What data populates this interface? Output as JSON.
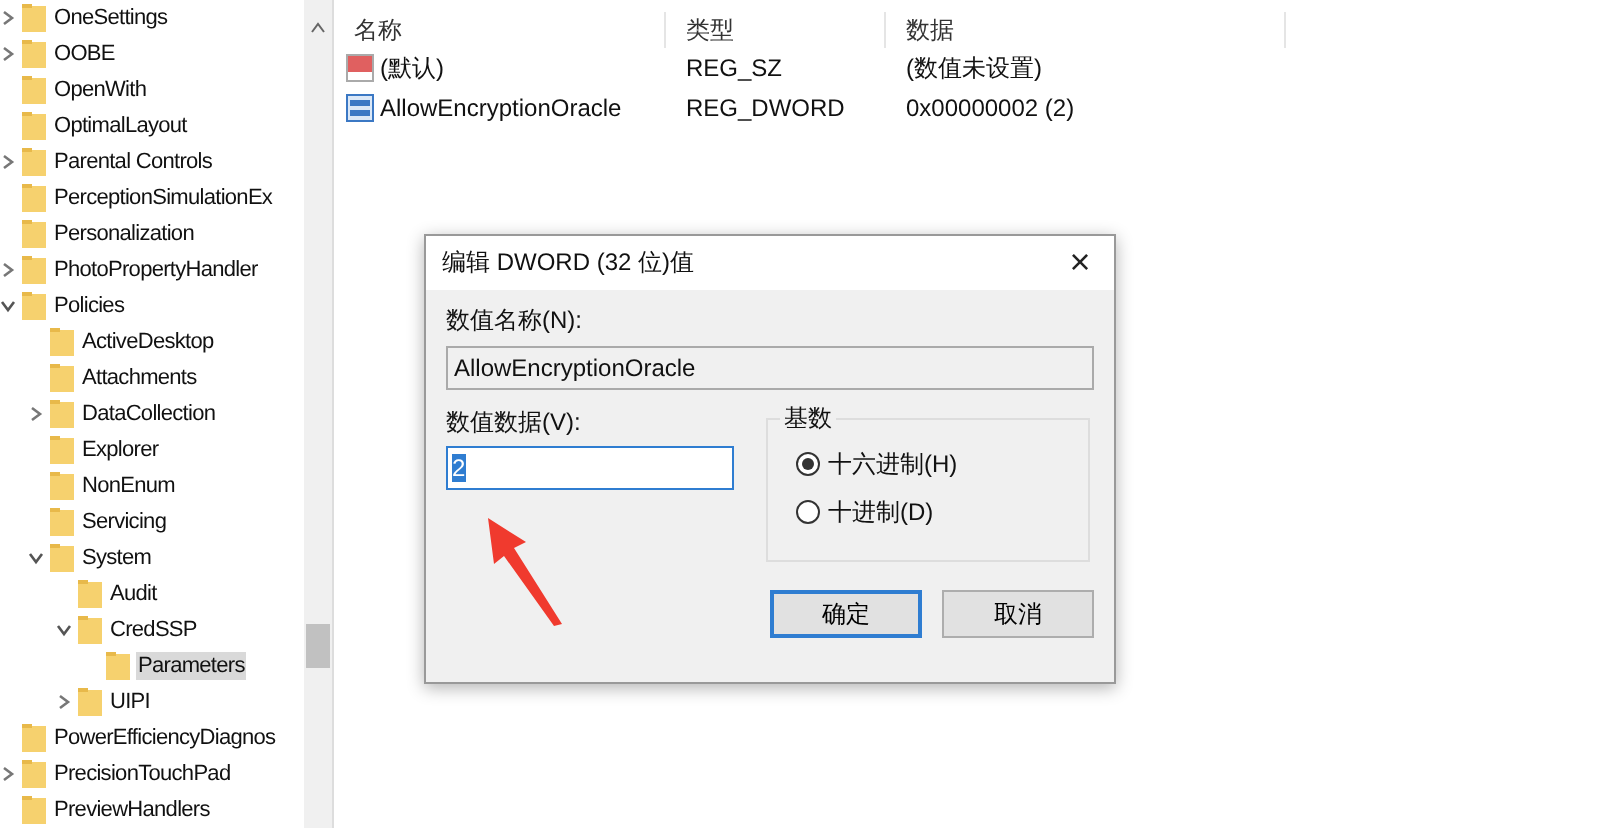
{
  "tree": [
    {
      "label": "OneSettings",
      "expanded": false,
      "selected": false
    },
    {
      "label": "OOBE",
      "expanded": false,
      "selected": false
    },
    {
      "label": "OpenWith",
      "selected": false
    },
    {
      "label": "OptimalLayout",
      "selected": false
    },
    {
      "label": "Parental Controls",
      "expanded": false,
      "selected": false
    },
    {
      "label": "PerceptionSimulationEx",
      "selected": false
    },
    {
      "label": "Personalization",
      "selected": false
    },
    {
      "label": "PhotoPropertyHandler",
      "expanded": false,
      "selected": false
    },
    {
      "label": "Policies",
      "expanded": true,
      "selected": false,
      "children": [
        {
          "label": "ActiveDesktop",
          "selected": false
        },
        {
          "label": "Attachments",
          "selected": false
        },
        {
          "label": "DataCollection",
          "expanded": false,
          "selected": false
        },
        {
          "label": "Explorer",
          "selected": false
        },
        {
          "label": "NonEnum",
          "selected": false
        },
        {
          "label": "Servicing",
          "selected": false
        },
        {
          "label": "System",
          "expanded": true,
          "selected": false,
          "children": [
            {
              "label": "Audit",
              "selected": false
            },
            {
              "label": "CredSSP",
              "expanded": true,
              "selected": false,
              "children": [
                {
                  "label": "Parameters",
                  "selected": true
                }
              ]
            },
            {
              "label": "UIPI",
              "expanded": false,
              "selected": false
            }
          ]
        }
      ]
    },
    {
      "label": "PowerEfficiencyDiagnos",
      "selected": false
    },
    {
      "label": "PrecisionTouchPad",
      "expanded": false,
      "selected": false
    },
    {
      "label": "PreviewHandlers",
      "selected": false
    }
  ],
  "values_table": {
    "columns": [
      "名称",
      "类型",
      "数据"
    ],
    "rows": [
      {
        "kind": "string",
        "name": "(默认)",
        "type": "REG_SZ",
        "data": "(数值未设置)"
      },
      {
        "kind": "binary",
        "name": "AllowEncryptionOracle",
        "type": "REG_DWORD",
        "data": "0x00000002 (2)"
      }
    ]
  },
  "dialog": {
    "title": "编辑 DWORD (32 位)值",
    "close": "×",
    "name_label": "数值名称(N):",
    "name_value": "AllowEncryptionOracle",
    "data_label": "数值数据(V):",
    "data_value": "2",
    "data_highlighted": true,
    "base_label": "基数",
    "bases": [
      {
        "label": "十六进制(H)",
        "selected": true
      },
      {
        "label": "十进制(D)",
        "selected": false
      }
    ],
    "buttons": [
      {
        "label": "确定",
        "default": true
      },
      {
        "label": "取消",
        "default": false
      }
    ]
  }
}
